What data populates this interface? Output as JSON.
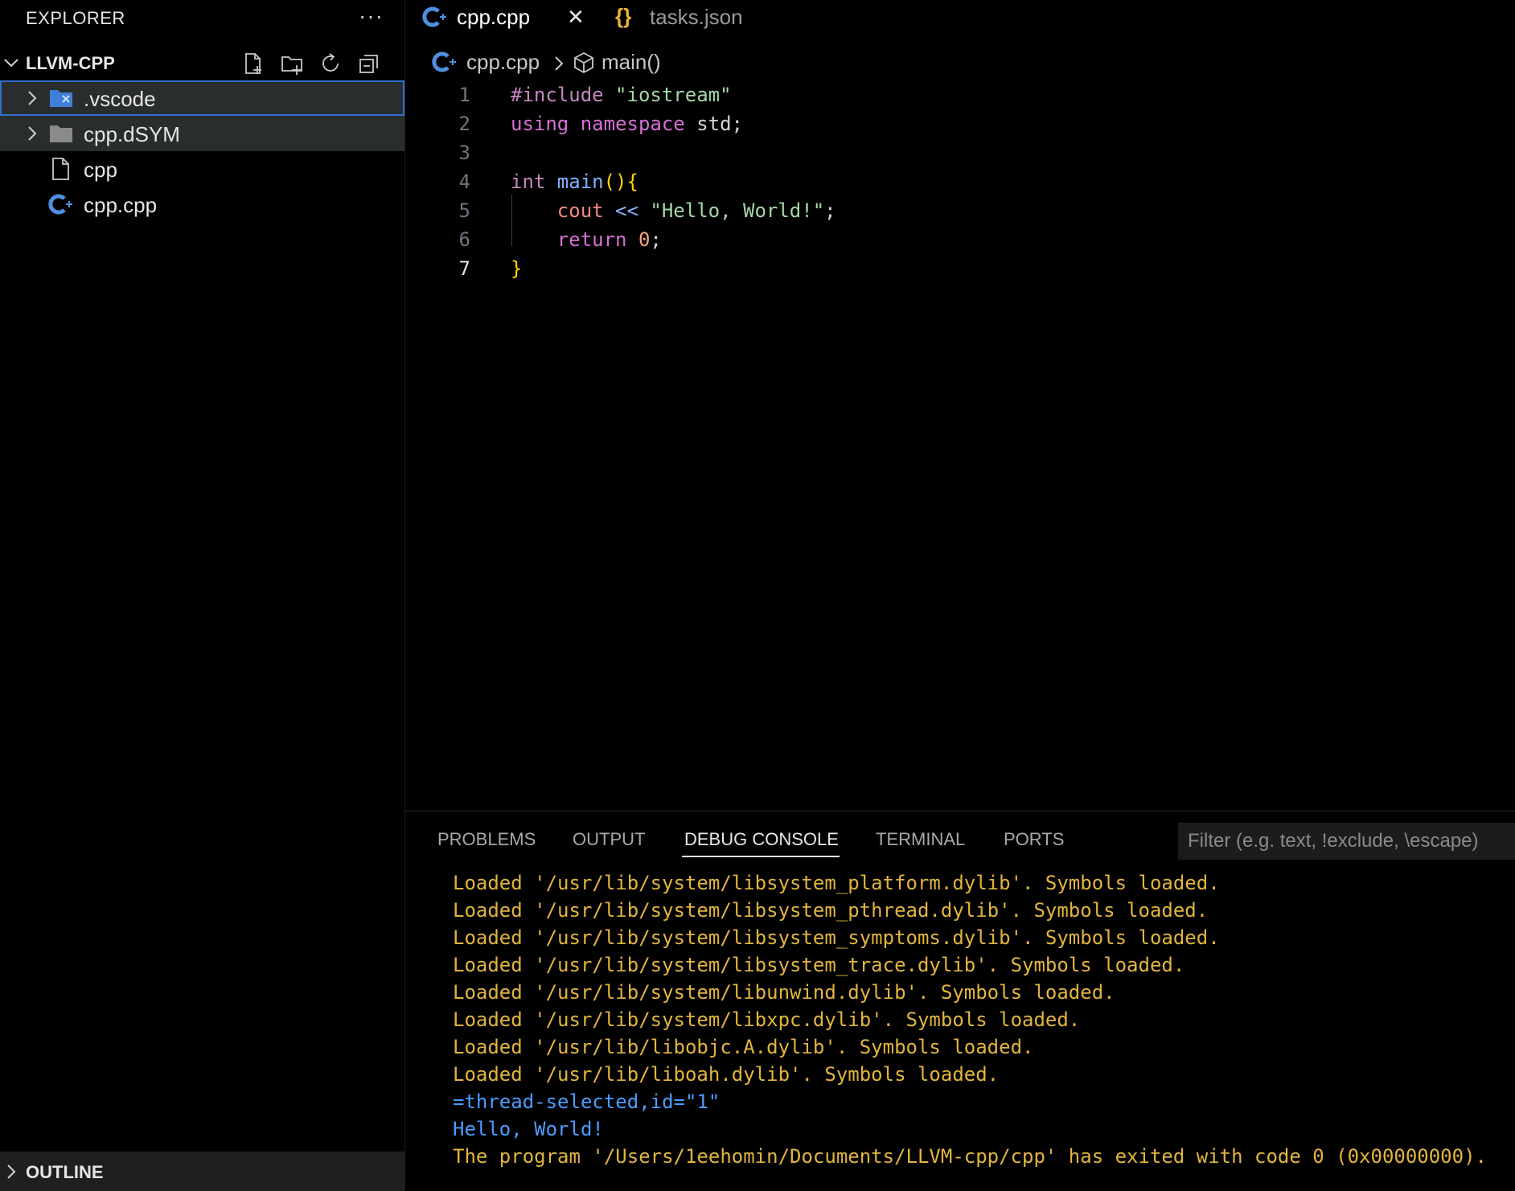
{
  "explorer": {
    "title": "EXPLORER",
    "more": "···",
    "folder": "LLVM-CPP",
    "items": [
      {
        "label": ".vscode",
        "kind": "vscode-folder"
      },
      {
        "label": "cpp.dSYM",
        "kind": "folder"
      },
      {
        "label": "cpp",
        "kind": "file"
      },
      {
        "label": "cpp.cpp",
        "kind": "cpp-file"
      }
    ],
    "outline": "OUTLINE"
  },
  "tabs": [
    {
      "label": "cpp.cpp",
      "active": true,
      "close": "✕"
    },
    {
      "label": "tasks.json",
      "active": false,
      "icon": "{}"
    }
  ],
  "breadcrumb": {
    "file": "cpp.cpp",
    "symbol": "main()"
  },
  "code": {
    "line_numbers": [
      "1",
      "2",
      "3",
      "4",
      "5",
      "6",
      "7"
    ],
    "lines": [
      [
        {
          "t": "#include ",
          "c": "pre"
        },
        {
          "t": "\"iostream\"",
          "c": "str"
        }
      ],
      [
        {
          "t": "using ",
          "c": "kw"
        },
        {
          "t": "namespace ",
          "c": "kw"
        },
        {
          "t": "std;",
          "c": "plain"
        }
      ],
      [],
      [
        {
          "t": "int ",
          "c": "type"
        },
        {
          "t": "main",
          "c": "fn"
        },
        {
          "t": "(){",
          "c": "paren"
        }
      ],
      [
        {
          "t": "    ",
          "c": "plain"
        },
        {
          "t": "cout ",
          "c": "var"
        },
        {
          "t": "<< ",
          "c": "op"
        },
        {
          "t": "\"Hello, World!\"",
          "c": "str"
        },
        {
          "t": ";",
          "c": "plain"
        }
      ],
      [
        {
          "t": "    ",
          "c": "plain"
        },
        {
          "t": "return ",
          "c": "kw"
        },
        {
          "t": "0",
          "c": "num"
        },
        {
          "t": ";",
          "c": "plain"
        }
      ],
      [
        {
          "t": "}",
          "c": "paren"
        }
      ]
    ]
  },
  "panel": {
    "tabs": [
      "PROBLEMS",
      "OUTPUT",
      "DEBUG CONSOLE",
      "TERMINAL",
      "PORTS"
    ],
    "active_tab": "DEBUG CONSOLE",
    "filter_placeholder": "Filter (e.g. text, !exclude, \\escape)",
    "console": [
      {
        "text": "Loaded '/usr/lib/system/libsystem_platform.dylib'. Symbols loaded.",
        "color": "#e2b53e"
      },
      {
        "text": "Loaded '/usr/lib/system/libsystem_pthread.dylib'. Symbols loaded.",
        "color": "#e2b53e"
      },
      {
        "text": "Loaded '/usr/lib/system/libsystem_symptoms.dylib'. Symbols loaded.",
        "color": "#e2b53e"
      },
      {
        "text": "Loaded '/usr/lib/system/libsystem_trace.dylib'. Symbols loaded.",
        "color": "#e2b53e"
      },
      {
        "text": "Loaded '/usr/lib/system/libunwind.dylib'. Symbols loaded.",
        "color": "#e2b53e"
      },
      {
        "text": "Loaded '/usr/lib/system/libxpc.dylib'. Symbols loaded.",
        "color": "#e2b53e"
      },
      {
        "text": "Loaded '/usr/lib/libobjc.A.dylib'. Symbols loaded.",
        "color": "#e2b53e"
      },
      {
        "text": "Loaded '/usr/lib/liboah.dylib'. Symbols loaded.",
        "color": "#e2b53e"
      },
      {
        "text": "=thread-selected,id=\"1\"",
        "color": "#4a9cff"
      },
      {
        "text": "Hello, World!",
        "color": "#4a9cff"
      },
      {
        "text": "The program '/Users/1eehomin/Documents/LLVM-cpp/cpp' has exited with code 0 (0x00000000).",
        "color": "#e2b53e"
      }
    ]
  },
  "colors": {
    "accent": "#2f6fd0",
    "cpp_icon": "#4f8fe0",
    "json_icon": "#e8b43c",
    "folder_icon": "#8a8a8a"
  }
}
